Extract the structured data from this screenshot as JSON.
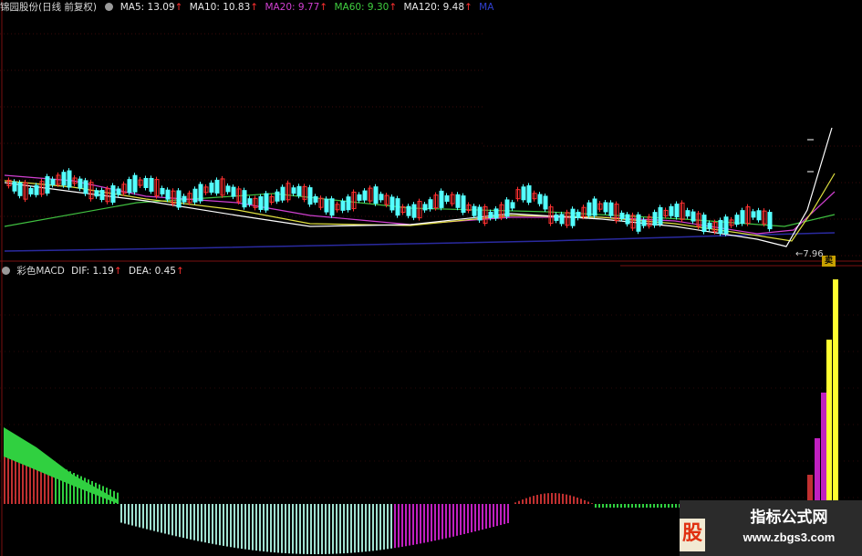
{
  "header": {
    "stock_name": "锦园股份(日线 前复权)",
    "ma5": "MA5: 13.09",
    "ma10": "MA10: 10.83",
    "ma20": "MA20: 9.77",
    "ma60": "MA60: 9.30",
    "ma120": "MA120: 9.48",
    "ma_extra": "MA"
  },
  "macd_header": {
    "name": "彩色MACD",
    "dif": "DIF: 1.19",
    "dea": "DEA: 0.45"
  },
  "arrow": "↑",
  "low_price_label": "7.96",
  "sell_marker": "卖",
  "watermark": {
    "logo_char": "股",
    "title": "指标公式网",
    "url": "www.zbgs3.com"
  },
  "colors": {
    "background": "#000000",
    "candle_up": "#ff3030",
    "candle_down": "#54ffff",
    "ma5": "#ffffff",
    "ma10": "#e0e040",
    "ma20": "#d040d0",
    "ma60": "#40c040",
    "ma120": "#2a2aa0",
    "macd_red": "#c03030",
    "macd_green": "#30d040",
    "macd_cyan": "#a0e0d0",
    "macd_magenta": "#c020c0",
    "macd_yellow": "#ffff30"
  },
  "chart_data": {
    "type": "candlestick",
    "series": [
      {
        "name": "MA5",
        "value": 13.09
      },
      {
        "name": "MA10",
        "value": 10.83
      },
      {
        "name": "MA20",
        "value": 9.77
      },
      {
        "name": "MA60",
        "value": 9.3
      },
      {
        "name": "MA120",
        "value": 9.48
      }
    ],
    "low_label": 7.96,
    "macd": {
      "dif": 1.19,
      "dea": 0.45
    }
  }
}
